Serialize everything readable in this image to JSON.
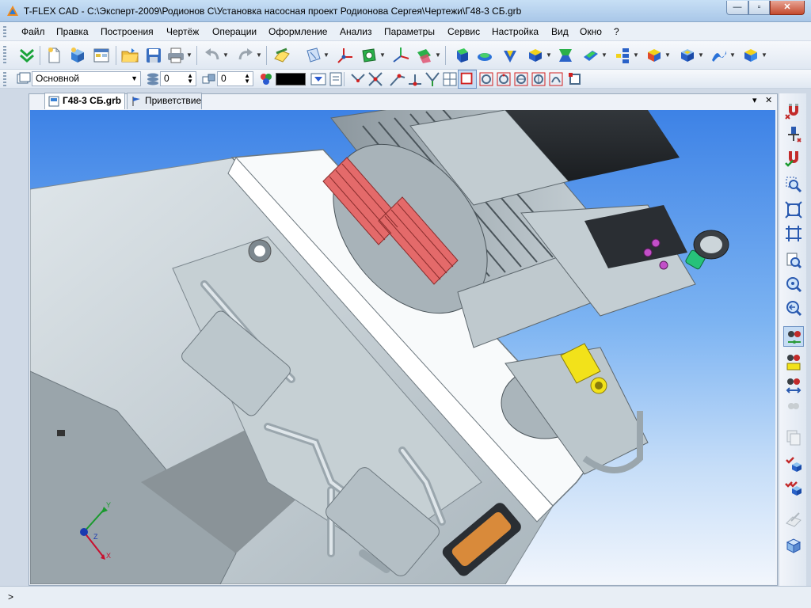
{
  "window": {
    "title": "T-FLEX CAD - C:\\Эксперт-2009\\Родионов С\\Установка насосная проект Родионова Сергея\\Чертежи\\Г48-3 СБ.grb",
    "min_glyph": "—",
    "max_glyph": "▫",
    "close_glyph": "✕"
  },
  "menu": [
    "Файл",
    "Правка",
    "Построения",
    "Чертёж",
    "Операции",
    "Оформление",
    "Анализ",
    "Параметры",
    "Сервис",
    "Настройка",
    "Вид",
    "Окно",
    "?"
  ],
  "properties_bar": {
    "layer_value": "Основной",
    "level_value": "0",
    "priority_value": "0",
    "color_hex": "#000000"
  },
  "tabs": [
    {
      "label": "Г48-3 СБ.grb",
      "active": true
    },
    {
      "label": "Приветствие",
      "active": false
    }
  ],
  "doc_controls": {
    "pin": "▾",
    "close": "✕"
  },
  "axis": {
    "x_label": "X",
    "y_label": "Y",
    "z_label": "Z",
    "x_color": "#c8102e",
    "y_color": "#1a9a2e",
    "z_color": "#1a3ab0"
  },
  "status": {
    "prompt": ">"
  },
  "colors": {
    "viewport_top": "#3d82e6",
    "viewport_bottom": "#f2f6fc",
    "model_gray": "#c9d3d8",
    "highlight_red": "#e46a6a",
    "highlight_yellow": "#f2e21a",
    "highlight_green": "#27c27a",
    "accent_pink": "#c24fc8"
  }
}
